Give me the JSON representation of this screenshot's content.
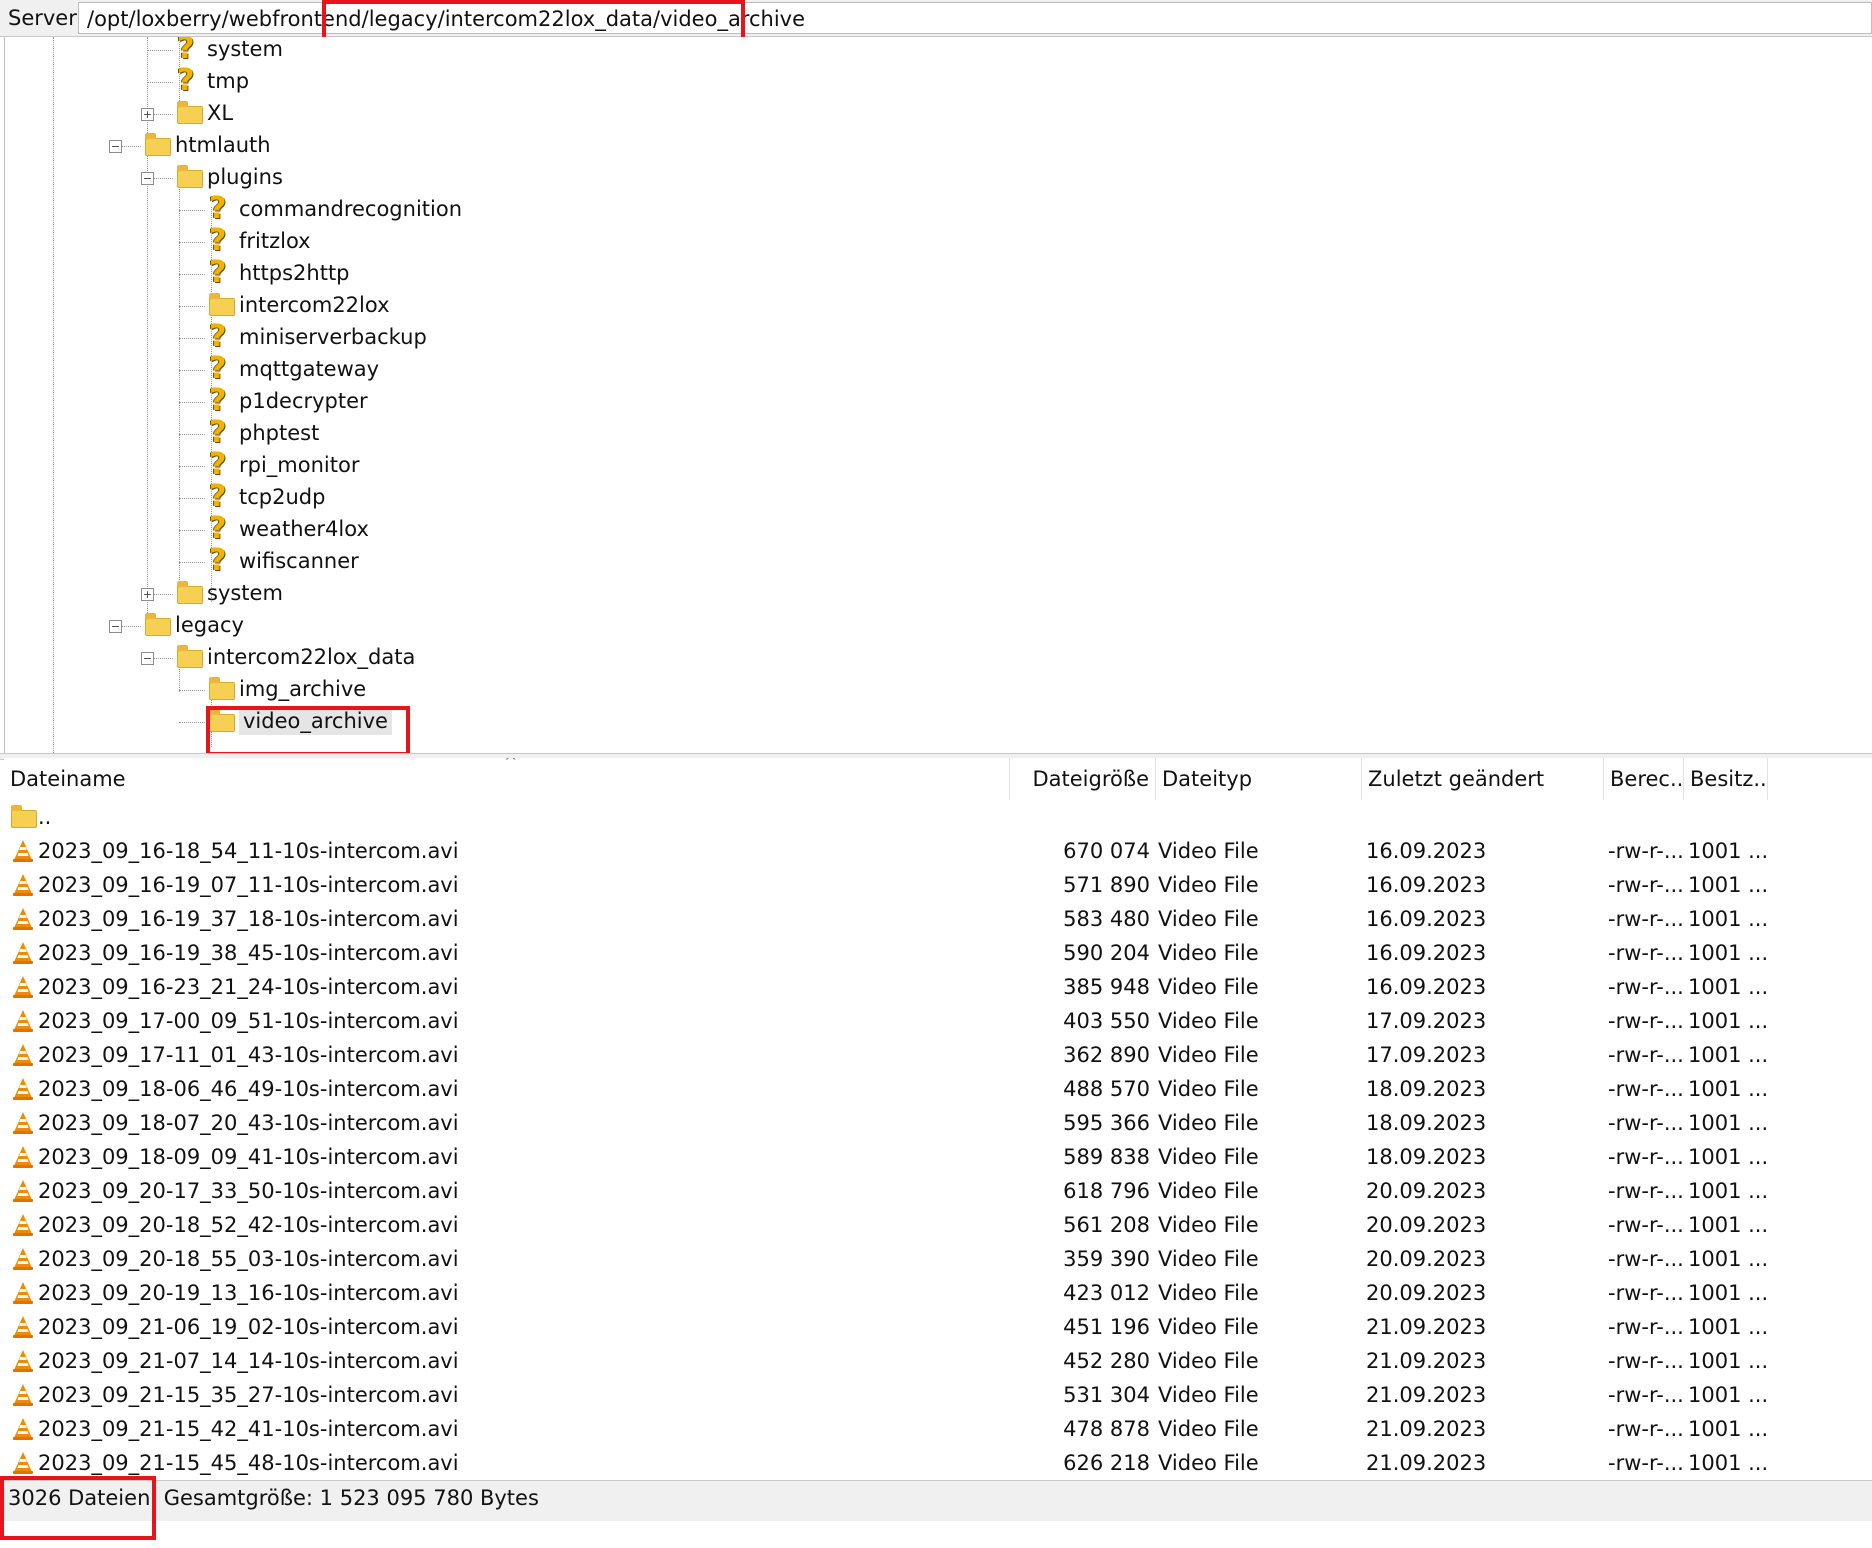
{
  "server_bar": {
    "label": "Server:",
    "path": "/opt/loxberry/webfrontend/legacy/intercom22lox_data/video_archive"
  },
  "tree": {
    "nodes": [
      {
        "label": "system",
        "icon": "question-folder-icon"
      },
      {
        "label": "tmp",
        "icon": "question-folder-icon"
      },
      {
        "label": "XL",
        "icon": "folder-icon",
        "expander": "+"
      },
      {
        "label": "htmlauth",
        "icon": "folder-icon",
        "expander": "-"
      },
      {
        "label": "plugins",
        "icon": "folder-icon",
        "expander": "-"
      },
      {
        "label": "commandrecognition",
        "icon": "question-folder-icon"
      },
      {
        "label": "fritzlox",
        "icon": "question-folder-icon"
      },
      {
        "label": "https2http",
        "icon": "question-folder-icon"
      },
      {
        "label": "intercom22lox",
        "icon": "folder-icon"
      },
      {
        "label": "miniserverbackup",
        "icon": "question-folder-icon"
      },
      {
        "label": "mqttgateway",
        "icon": "question-folder-icon"
      },
      {
        "label": "p1decrypter",
        "icon": "question-folder-icon"
      },
      {
        "label": "phptest",
        "icon": "question-folder-icon"
      },
      {
        "label": "rpi_monitor",
        "icon": "question-folder-icon"
      },
      {
        "label": "tcp2udp",
        "icon": "question-folder-icon"
      },
      {
        "label": "weather4lox",
        "icon": "question-folder-icon"
      },
      {
        "label": "wifiscanner",
        "icon": "question-folder-icon"
      },
      {
        "label": "system",
        "icon": "folder-icon",
        "expander": "+"
      },
      {
        "label": "legacy",
        "icon": "folder-icon",
        "expander": "-"
      },
      {
        "label": "intercom22lox_data",
        "icon": "folder-icon",
        "expander": "-"
      },
      {
        "label": "img_archive",
        "icon": "folder-icon"
      },
      {
        "label": "video_archive",
        "icon": "folder-icon",
        "selected": true
      }
    ]
  },
  "file_list": {
    "columns": [
      "Dateiname",
      "Dateigröße",
      "Dateityp",
      "Zuletzt geändert",
      "Berec...",
      "Besitz..."
    ],
    "parent_entry": "..",
    "files": [
      {
        "name": "2023_09_16-18_54_11-10s-intercom.avi",
        "size": "670 074",
        "type": "Video File",
        "modified": "16.09.2023",
        "perms": "-rw-r-...",
        "owner": "1001 ..."
      },
      {
        "name": "2023_09_16-19_07_11-10s-intercom.avi",
        "size": "571 890",
        "type": "Video File",
        "modified": "16.09.2023",
        "perms": "-rw-r-...",
        "owner": "1001 ..."
      },
      {
        "name": "2023_09_16-19_37_18-10s-intercom.avi",
        "size": "583 480",
        "type": "Video File",
        "modified": "16.09.2023",
        "perms": "-rw-r-...",
        "owner": "1001 ..."
      },
      {
        "name": "2023_09_16-19_38_45-10s-intercom.avi",
        "size": "590 204",
        "type": "Video File",
        "modified": "16.09.2023",
        "perms": "-rw-r-...",
        "owner": "1001 ..."
      },
      {
        "name": "2023_09_16-23_21_24-10s-intercom.avi",
        "size": "385 948",
        "type": "Video File",
        "modified": "16.09.2023",
        "perms": "-rw-r-...",
        "owner": "1001 ..."
      },
      {
        "name": "2023_09_17-00_09_51-10s-intercom.avi",
        "size": "403 550",
        "type": "Video File",
        "modified": "17.09.2023",
        "perms": "-rw-r-...",
        "owner": "1001 ..."
      },
      {
        "name": "2023_09_17-11_01_43-10s-intercom.avi",
        "size": "362 890",
        "type": "Video File",
        "modified": "17.09.2023",
        "perms": "-rw-r-...",
        "owner": "1001 ..."
      },
      {
        "name": "2023_09_18-06_46_49-10s-intercom.avi",
        "size": "488 570",
        "type": "Video File",
        "modified": "18.09.2023",
        "perms": "-rw-r-...",
        "owner": "1001 ..."
      },
      {
        "name": "2023_09_18-07_20_43-10s-intercom.avi",
        "size": "595 366",
        "type": "Video File",
        "modified": "18.09.2023",
        "perms": "-rw-r-...",
        "owner": "1001 ..."
      },
      {
        "name": "2023_09_18-09_09_41-10s-intercom.avi",
        "size": "589 838",
        "type": "Video File",
        "modified": "18.09.2023",
        "perms": "-rw-r-...",
        "owner": "1001 ..."
      },
      {
        "name": "2023_09_20-17_33_50-10s-intercom.avi",
        "size": "618 796",
        "type": "Video File",
        "modified": "20.09.2023",
        "perms": "-rw-r-...",
        "owner": "1001 ..."
      },
      {
        "name": "2023_09_20-18_52_42-10s-intercom.avi",
        "size": "561 208",
        "type": "Video File",
        "modified": "20.09.2023",
        "perms": "-rw-r-...",
        "owner": "1001 ..."
      },
      {
        "name": "2023_09_20-18_55_03-10s-intercom.avi",
        "size": "359 390",
        "type": "Video File",
        "modified": "20.09.2023",
        "perms": "-rw-r-...",
        "owner": "1001 ..."
      },
      {
        "name": "2023_09_20-19_13_16-10s-intercom.avi",
        "size": "423 012",
        "type": "Video File",
        "modified": "20.09.2023",
        "perms": "-rw-r-...",
        "owner": "1001 ..."
      },
      {
        "name": "2023_09_21-06_19_02-10s-intercom.avi",
        "size": "451 196",
        "type": "Video File",
        "modified": "21.09.2023",
        "perms": "-rw-r-...",
        "owner": "1001 ..."
      },
      {
        "name": "2023_09_21-07_14_14-10s-intercom.avi",
        "size": "452 280",
        "type": "Video File",
        "modified": "21.09.2023",
        "perms": "-rw-r-...",
        "owner": "1001 ..."
      },
      {
        "name": "2023_09_21-15_35_27-10s-intercom.avi",
        "size": "531 304",
        "type": "Video File",
        "modified": "21.09.2023",
        "perms": "-rw-r-...",
        "owner": "1001 ..."
      },
      {
        "name": "2023_09_21-15_42_41-10s-intercom.avi",
        "size": "478 878",
        "type": "Video File",
        "modified": "21.09.2023",
        "perms": "-rw-r-...",
        "owner": "1001 ..."
      },
      {
        "name": "2023_09_21-15_45_48-10s-intercom.avi",
        "size": "626 218",
        "type": "Video File",
        "modified": "21.09.2023",
        "perms": "-rw-r-...",
        "owner": "1001 ..."
      }
    ]
  },
  "status_bar": {
    "text": "3026 Dateien. Gesamtgröße: 1 523 095 780 Bytes"
  },
  "colors": {
    "highlight_red": "#e8141b",
    "folder_yellow": "#f7cf52",
    "vlc_orange": "#f08a00"
  }
}
